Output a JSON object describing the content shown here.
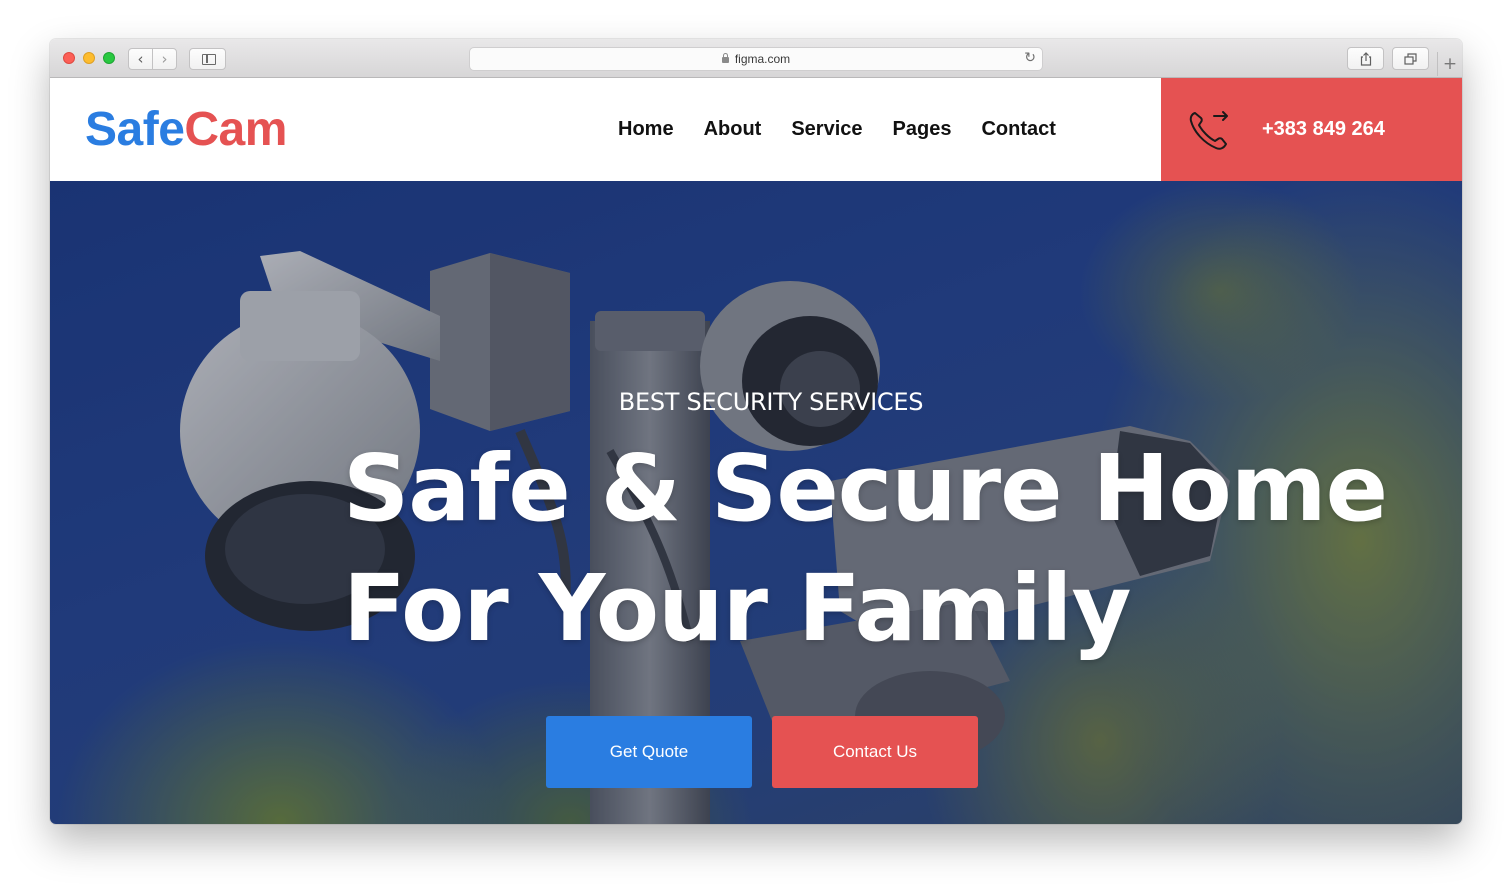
{
  "browser": {
    "url": "figma.com"
  },
  "header": {
    "logo_part1": "Safe",
    "logo_part2": "Cam",
    "nav": [
      "Home",
      "About",
      "Service",
      "Pages",
      "Contact"
    ],
    "phone": "+383 849 264"
  },
  "hero": {
    "eyebrow": "BEST SECURITY SERVICES",
    "headline_line1": "Safe & Secure Home",
    "headline_line2": "For Your Family",
    "cta_primary": "Get Quote",
    "cta_secondary": "Contact Us"
  },
  "colors": {
    "brand_blue": "#2a7de1",
    "brand_red": "#e55252"
  }
}
